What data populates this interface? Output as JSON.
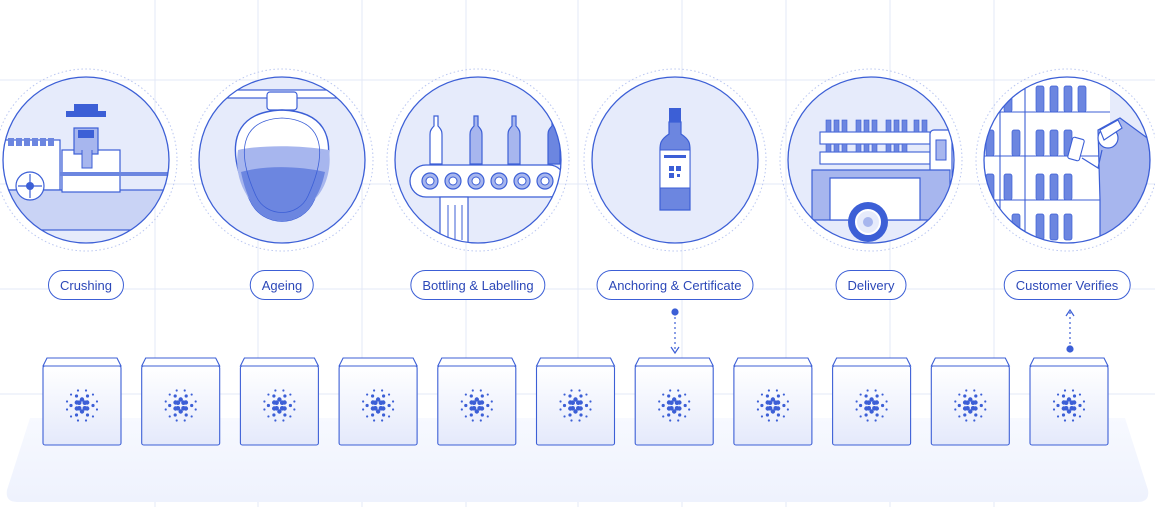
{
  "stages": [
    {
      "label": "Crushing",
      "icon": "crushing-illustration"
    },
    {
      "label": "Ageing",
      "icon": "ageing-amphora-illustration"
    },
    {
      "label": "Bottling & Labelling",
      "icon": "bottling-conveyor-illustration"
    },
    {
      "label": "Anchoring & Certificate",
      "icon": "wine-bottle-qr-illustration"
    },
    {
      "label": "Delivery",
      "icon": "delivery-truck-illustration"
    },
    {
      "label": "Customer Verifies",
      "icon": "customer-scanning-illustration"
    }
  ],
  "blockchain": {
    "block_count": 11,
    "block_icon": "cardano-logo-icon",
    "write_link": {
      "from_stage": 3,
      "to_block": 6
    },
    "read_link": {
      "from_block": 10,
      "to_stage": 5
    }
  },
  "colors": {
    "accent": "#3c5fd6",
    "accent_dark": "#2c48b8",
    "light_fill": "#e6ebfb",
    "mid_fill": "#a7b6ee",
    "grid": "#e3e8f7"
  }
}
